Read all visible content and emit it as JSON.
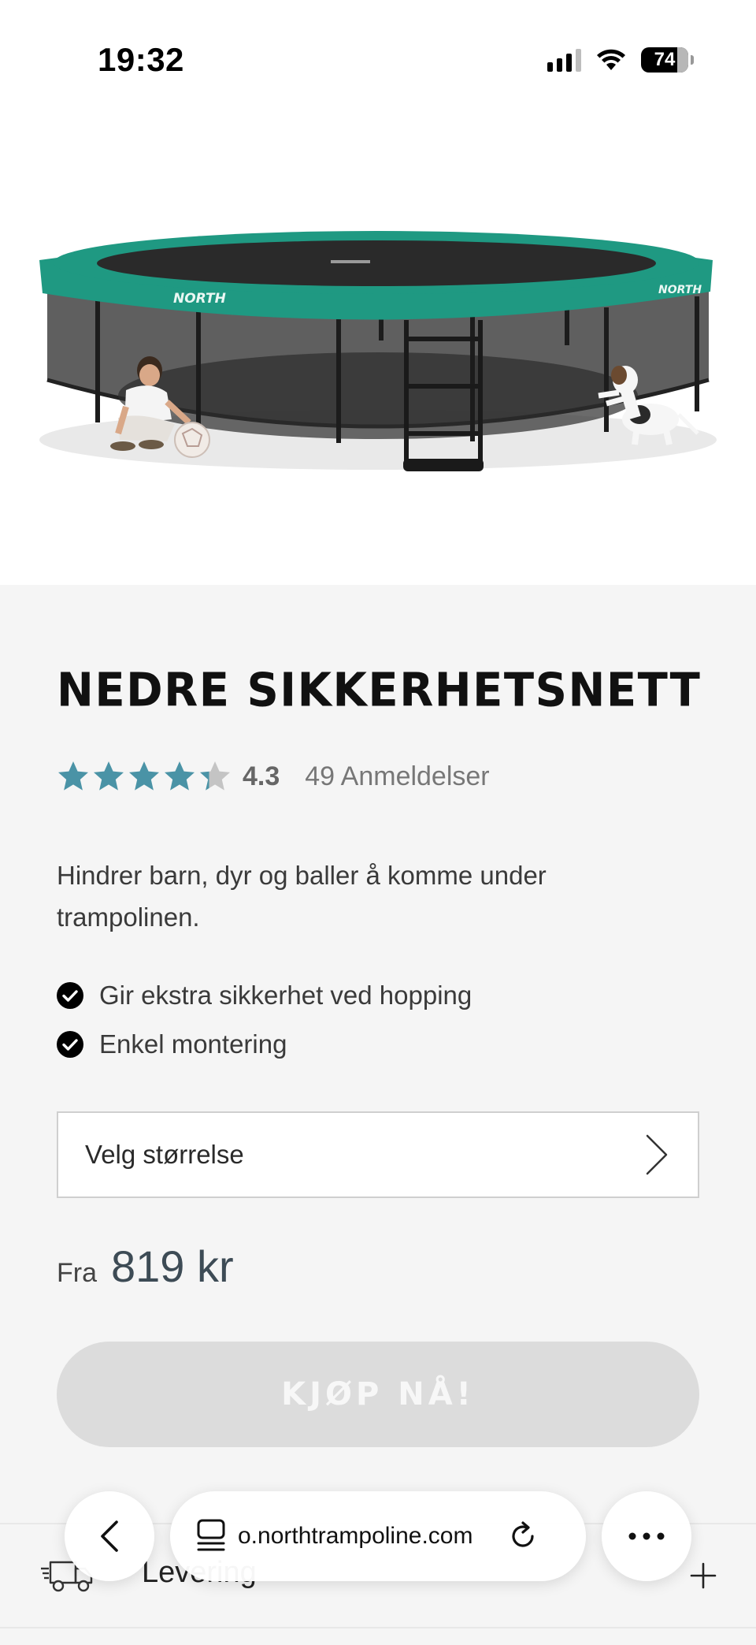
{
  "status_bar": {
    "time": "19:32",
    "battery": "74"
  },
  "hero": {
    "brand_text_front": "NORTH",
    "brand_text_side": "NORTH"
  },
  "product": {
    "title": "NEDRE SIKKERHETSNETT",
    "rating": {
      "value": 4.3,
      "value_label": "4.3",
      "reviews_label": "49 Anmeldelser",
      "stars_max": 5
    },
    "description": "Hindrer barn, dyr og baller å komme under trampolinen.",
    "features": [
      "Gir ekstra sikkerhet ved hopping",
      "Enkel montering"
    ],
    "size_select": {
      "label": "Velg størrelse"
    },
    "price": {
      "prefix": "Fra",
      "value": "819 kr"
    },
    "buy_button": {
      "label": "KJØP NÅ!",
      "disabled": true
    }
  },
  "delivery": {
    "label": "Levering"
  },
  "browser": {
    "url": "o.northtrampoline.com"
  },
  "colors": {
    "star": "#4a93a6",
    "star_empty": "#c4c4c4",
    "trampoline_pad": "#1f9982",
    "content_bg": "#f5f5f5",
    "button_disabled": "#dcdcdc"
  },
  "icons": [
    "signal-icon",
    "wifi-icon",
    "battery-icon",
    "star-icon",
    "check-icon",
    "chevron-right-icon",
    "truck-icon",
    "plus-icon",
    "back-icon",
    "tabs-icon",
    "reload-icon",
    "more-icon"
  ]
}
